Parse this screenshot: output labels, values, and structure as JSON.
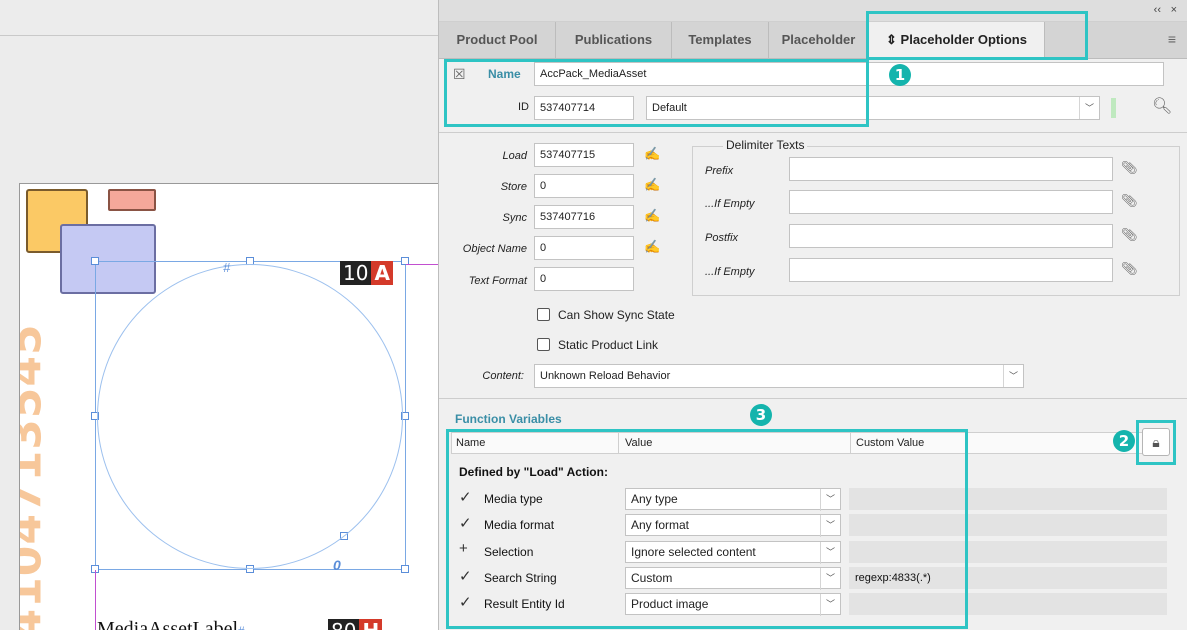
{
  "canvas": {
    "barcode_text": "4104713545",
    "badge_top": {
      "number": "10",
      "letter": "A"
    },
    "badge_bottom": {
      "number": "80",
      "letter": "H"
    },
    "media_label": "MediaAssetLabel",
    "hash_mark": "#",
    "zero_mark": "0"
  },
  "panel": {
    "window_controls": {
      "collapse": "‹‹",
      "close": "×"
    },
    "tabs": [
      {
        "label": "Product Pool"
      },
      {
        "label": "Publications"
      },
      {
        "label": "Templates"
      },
      {
        "label": "Placeholder"
      },
      {
        "label": "Placeholder Options",
        "icon": "updown-icon",
        "active": true
      }
    ],
    "menu_icon": "≡",
    "name_label": "Name",
    "name_value": "AccPack_MediaAsset",
    "id_label": "ID",
    "id_value": "537407714",
    "id_mode": "Default",
    "fields": [
      {
        "label": "Load",
        "value": "537407715"
      },
      {
        "label": "Store",
        "value": "0"
      },
      {
        "label": "Sync",
        "value": "537407716"
      },
      {
        "label": "Object Name",
        "value": "0"
      },
      {
        "label": "Text Format",
        "value": "0"
      }
    ],
    "delimiter": {
      "legend": "Delimiter Texts",
      "rows": [
        {
          "label": "Prefix",
          "value": ""
        },
        {
          "label": "...If Empty",
          "value": ""
        },
        {
          "label": "Postfix",
          "value": ""
        },
        {
          "label": "...If Empty",
          "value": ""
        }
      ]
    },
    "can_show_sync_state": "Can Show Sync State",
    "static_product_link": "Static Product Link",
    "content_label": "Content:",
    "content_value": "Unknown Reload Behavior",
    "function_variables": {
      "title": "Function Variables",
      "columns": [
        "Name",
        "Value",
        "Custom Value"
      ],
      "group": "Defined by \"Load\" Action:",
      "rows": [
        {
          "mark": "✓",
          "name": "Media type",
          "value": "Any type",
          "custom": ""
        },
        {
          "mark": "✓",
          "name": "Media format",
          "value": "Any format",
          "custom": ""
        },
        {
          "mark": "+",
          "name": "Selection",
          "value": "Ignore selected content",
          "custom": ""
        },
        {
          "mark": "✓",
          "name": "Search String",
          "value": "Custom",
          "custom": "regexp:4833(.*)"
        },
        {
          "mark": "✓",
          "name": "Result Entity Id",
          "value": "Product image",
          "custom": ""
        }
      ]
    },
    "callouts": [
      "1",
      "2",
      "3"
    ],
    "accent_color": "#2ec4c4",
    "badge_color": "#14b4ad"
  }
}
